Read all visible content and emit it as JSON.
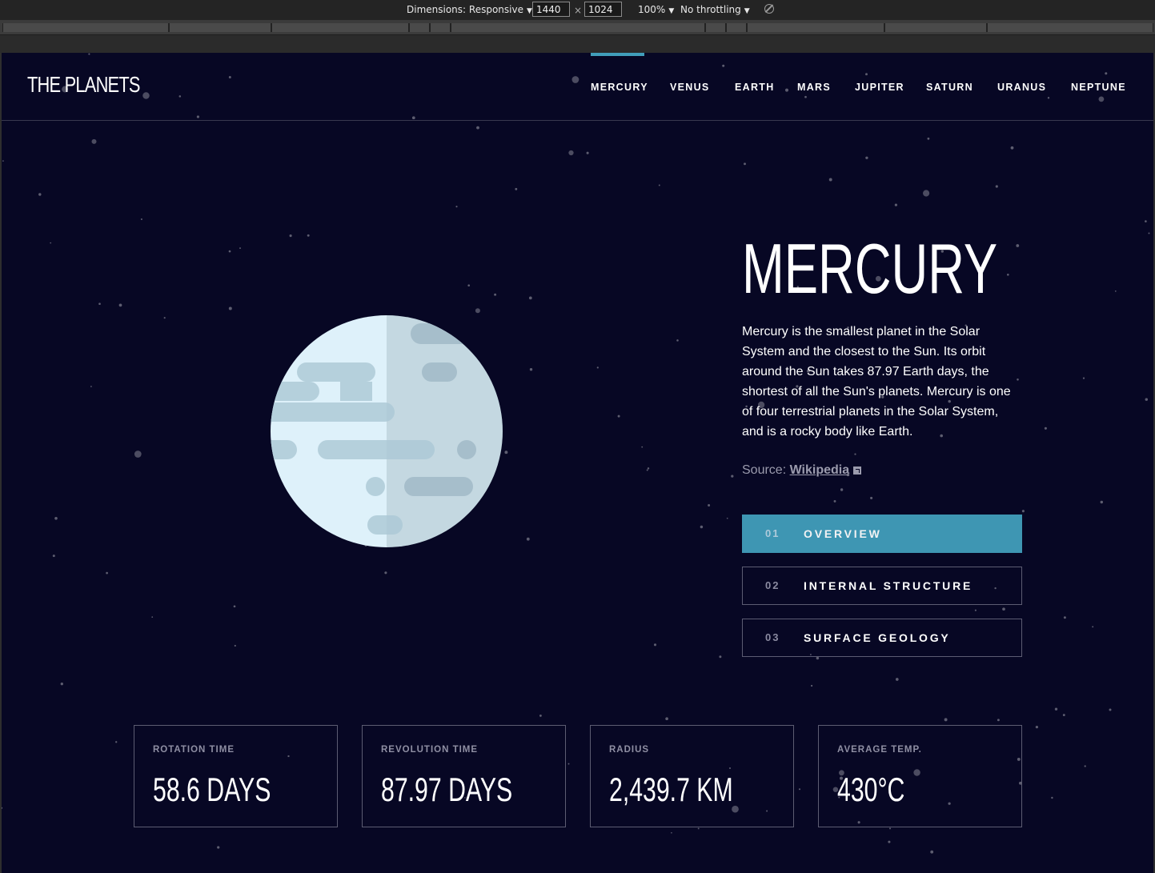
{
  "devtools": {
    "dimensions_label": "Dimensions: Responsive",
    "width": "1440",
    "times": "×",
    "height": "1024",
    "zoom": "100%",
    "throttling": "No throttling",
    "rotate_icon": "rotate-icon"
  },
  "header": {
    "logo": "THE PLANETS",
    "nav": [
      "MERCURY",
      "VENUS",
      "EARTH",
      "MARS",
      "JUPITER",
      "SATURN",
      "URANUS",
      "NEPTUNE"
    ],
    "active": "MERCURY",
    "accent_color": "#419EBB"
  },
  "planet": {
    "name": "MERCURY",
    "description": "Mercury is the smallest planet in the Solar System and the closest to the Sun. Its orbit around the Sun takes 87.97 Earth days, the shortest of all the Sun's planets. Mercury is one of four terrestrial planets in the Solar System, and is a rocky body like Earth.",
    "source_label": "Source:",
    "source_link": "Wikipedia",
    "source_icon": "external-link-icon"
  },
  "tabs": [
    {
      "num": "01",
      "label": "OVERVIEW",
      "active": true
    },
    {
      "num": "02",
      "label": "INTERNAL STRUCTURE",
      "active": false
    },
    {
      "num": "03",
      "label": "SURFACE GEOLOGY",
      "active": false
    }
  ],
  "stats": [
    {
      "label": "ROTATION TIME",
      "value": "58.6 DAYS"
    },
    {
      "label": "REVOLUTION TIME",
      "value": "87.97 DAYS"
    },
    {
      "label": "RADIUS",
      "value": "2,439.7 KM"
    },
    {
      "label": "AVERAGE TEMP.",
      "value": "430°C"
    }
  ],
  "colors": {
    "background": "#070724",
    "border": "#38384F",
    "active_tab": "#419EBB",
    "planet_light": "#DEF4FC",
    "planet_shade": "#B4CED8"
  }
}
